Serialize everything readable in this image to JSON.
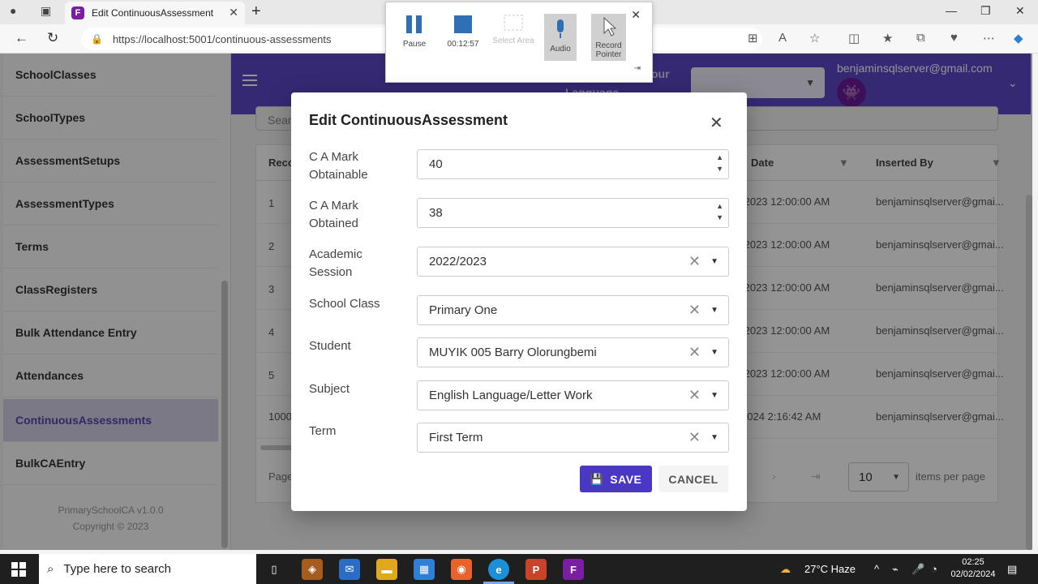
{
  "browser": {
    "tab_title": "Edit ContinuousAssessment",
    "favicon_letter": "F",
    "url": "https://localhost:5001/continuous-assessments"
  },
  "sidebar": {
    "items": [
      {
        "label": "SchoolClasses"
      },
      {
        "label": "SchoolTypes"
      },
      {
        "label": "AssessmentSetups"
      },
      {
        "label": "AssessmentTypes"
      },
      {
        "label": "Terms"
      },
      {
        "label": "ClassRegisters"
      },
      {
        "label": "Bulk Attendance Entry"
      },
      {
        "label": "Attendances"
      },
      {
        "label": "ContinuousAssessments"
      },
      {
        "label": "BulkCAEntry"
      }
    ],
    "active_item": "ContinuousAssessments",
    "version": "PrimarySchoolCA v1.0.0",
    "copyright": "Copyright © 2023"
  },
  "appbar": {
    "partial_text_1": "our",
    "partial_text_2": "Language",
    "user_email": "benjaminsqlserver@gmail.com",
    "accent": "#5c47c9"
  },
  "grid": {
    "search_placeholder": "Sear",
    "headers": {
      "record": "Reco",
      "date": "Date",
      "inserted_by": "Inserted By"
    },
    "rows": [
      {
        "id": "1",
        "date": "/2023 12:00:00 AM",
        "by": "benjaminsqlserver@gmai..."
      },
      {
        "id": "2",
        "date": "/2023 12:00:00 AM",
        "by": "benjaminsqlserver@gmai..."
      },
      {
        "id": "3",
        "date": "/2023 12:00:00 AM",
        "by": "benjaminsqlserver@gmai..."
      },
      {
        "id": "4",
        "date": "/2023 12:00:00 AM",
        "by": "benjaminsqlserver@gmai..."
      },
      {
        "id": "5",
        "date": "/2023 12:00:00 AM",
        "by": "benjaminsqlserver@gmai..."
      },
      {
        "id": "1000",
        "date": "2024 2:16:42 AM",
        "by": "benjaminsqlserver@gmai..."
      }
    ],
    "pager_label": "Page",
    "page_size": "10",
    "items_per_page": "items per page"
  },
  "recorder": {
    "pause": "Pause",
    "elapsed": "00:12:57",
    "select_area": "Select Area",
    "audio": "Audio",
    "record_pointer": "Record Pointer"
  },
  "dialog": {
    "title": "Edit ContinuousAssessment",
    "fields": [
      {
        "label": "C A Mark Obtainable",
        "value": "40",
        "kind": "number"
      },
      {
        "label": "C A Mark Obtained",
        "value": "38",
        "kind": "number"
      },
      {
        "label": "Academic Session",
        "value": "2022/2023",
        "kind": "dropdown"
      },
      {
        "label": "School Class",
        "value": "Primary One",
        "kind": "dropdown"
      },
      {
        "label": "Student",
        "value": "MUYIK 005 Barry Olorungbemi",
        "kind": "dropdown"
      },
      {
        "label": "Subject",
        "value": "English Language/Letter Work",
        "kind": "dropdown"
      },
      {
        "label": "Term",
        "value": "First Term",
        "kind": "dropdown"
      }
    ],
    "save_label": "SAVE",
    "cancel_label": "CANCEL",
    "save_color": "#4a37c6"
  },
  "taskbar": {
    "search_placeholder": "Type here to search",
    "weather": "27°C  Haze",
    "time": "02:25",
    "date": "02/02/2024"
  }
}
